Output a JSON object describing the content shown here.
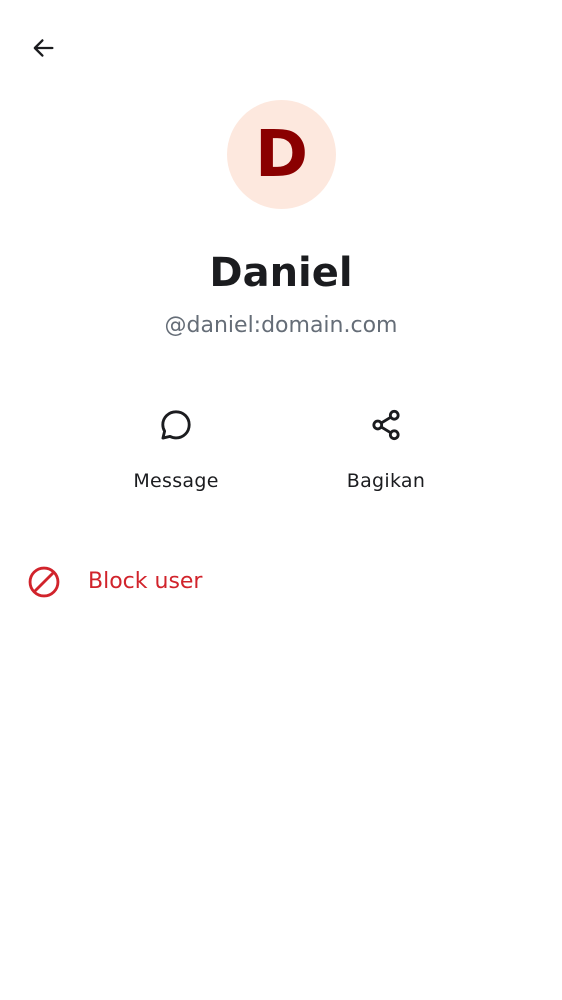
{
  "colors": {
    "avatar_background": "#fde8de",
    "avatar_letter": "#8a0000",
    "text_primary": "#1b1c1f",
    "text_secondary": "#656d77",
    "critical": "#d1232b"
  },
  "header": {
    "back_icon": "arrow-left-icon"
  },
  "profile": {
    "avatar_initial": "D",
    "display_name": "Daniel",
    "user_id": "@daniel:domain.com"
  },
  "actions": [
    {
      "label": "Message",
      "icon": "chat-bubble-icon"
    },
    {
      "label": "Bagikan",
      "icon": "share-icon"
    }
  ],
  "block": {
    "label": "Block user",
    "icon": "block-icon"
  }
}
